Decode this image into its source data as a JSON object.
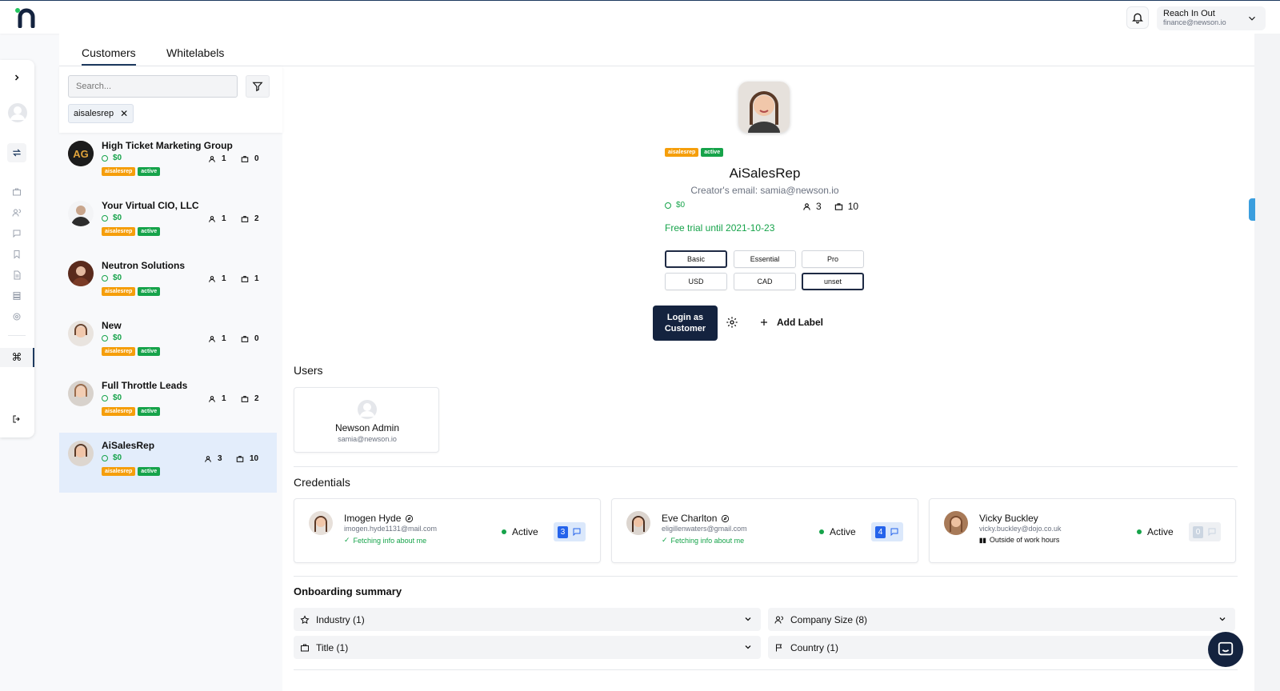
{
  "account": {
    "name": "Reach In Out",
    "email": "finance@newson.io"
  },
  "tabs": [
    "Customers",
    "Whitelabels"
  ],
  "search": {
    "placeholder": "Search..."
  },
  "filter_chip": "aisalesrep",
  "customers": [
    {
      "name": "High Ticket Marketing Group",
      "amount": "$0",
      "tag1": "aisalesrep",
      "tag2": "active",
      "users": "1",
      "companies": "0"
    },
    {
      "name": "Your Virtual CIO, LLC",
      "amount": "$0",
      "tag1": "aisalesrep",
      "tag2": "active",
      "users": "1",
      "companies": "2"
    },
    {
      "name": "Neutron Solutions",
      "amount": "$0",
      "tag1": "aisalesrep",
      "tag2": "active",
      "users": "1",
      "companies": "1"
    },
    {
      "name": "New",
      "amount": "$0",
      "tag1": "aisalesrep",
      "tag2": "active",
      "users": "1",
      "companies": "0"
    },
    {
      "name": "Full Throttle Leads",
      "amount": "$0",
      "tag1": "aisalesrep",
      "tag2": "active",
      "users": "1",
      "companies": "2"
    },
    {
      "name": "AiSalesRep",
      "amount": "$0",
      "tag1": "aisalesrep",
      "tag2": "active",
      "users": "3",
      "companies": "10"
    }
  ],
  "detail": {
    "tag1": "aisalesrep",
    "tag2": "active",
    "name": "AiSalesRep",
    "creator": "Creator's email: samia@newson.io",
    "amount": "$0",
    "users": "3",
    "companies": "10",
    "trial": "Free trial until 2021-10-23",
    "plans": [
      "Basic",
      "Essential",
      "Pro"
    ],
    "currencies": [
      "USD",
      "CAD",
      "unset"
    ],
    "login_label": "Login as Customer",
    "add_label": "Add Label"
  },
  "users_section": {
    "title": "Users",
    "user_name": "Newson Admin",
    "user_email": "samia@newson.io"
  },
  "credentials_section": {
    "title": "Credentials",
    "items": [
      {
        "name": "Imogen Hyde",
        "email": "imogen.hyde1131@mail.com",
        "status_note": "Fetching info about me",
        "state": "Active",
        "count": "3"
      },
      {
        "name": "Eve Charlton",
        "email": "eligillenwaters@gmail.com",
        "status_note": "Fetching info about me",
        "state": "Active",
        "count": "4"
      },
      {
        "name": "Vicky Buckley",
        "email": "vicky.buckley@dojo.co.uk",
        "status_note": "Outside of work hours",
        "state": "Active",
        "count": "0"
      }
    ]
  },
  "onboarding": {
    "title": "Onboarding summary",
    "items": [
      "Industry (1)",
      "Company Size (8)",
      "Title (1)",
      "Country (1)"
    ]
  },
  "colors": {
    "brand_navy": "#14233f",
    "active_green": "#16a34a",
    "tag_orange": "#f59e0b",
    "selected_row": "#e3edfb"
  }
}
